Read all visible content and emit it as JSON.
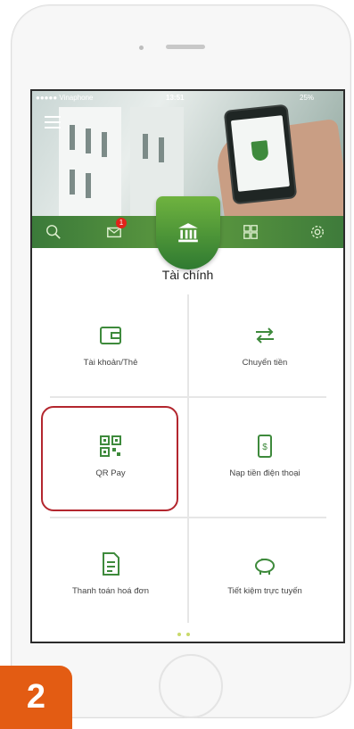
{
  "status_bar": {
    "carrier": "●●●●● Vinaphone",
    "time": "13:51",
    "battery": "25%"
  },
  "tabbar": {
    "tabs": [
      "search-icon",
      "mail-icon",
      "bank-icon",
      "qr-grid-icon",
      "settings-icon"
    ],
    "notification_count": "1"
  },
  "section_title": "Tài chính",
  "grid": [
    {
      "label": "Tài khoản/Thẻ",
      "icon": "wallet-icon"
    },
    {
      "label": "Chuyển tiền",
      "icon": "transfer-icon"
    },
    {
      "label": "QR Pay",
      "icon": "qr-code-icon"
    },
    {
      "label": "Nạp tiền điện thoại",
      "icon": "phone-topup-icon"
    },
    {
      "label": "Thanh toán hoá đơn",
      "icon": "bill-icon"
    },
    {
      "label": "Tiết kiệm trực tuyến",
      "icon": "piggy-bank-icon"
    }
  ],
  "step_number": "2",
  "colors": {
    "brand_green": "#3b7a3a",
    "icon_green": "#3e8a3c",
    "highlight_red": "#b3262e",
    "step_orange": "#e35c13"
  }
}
